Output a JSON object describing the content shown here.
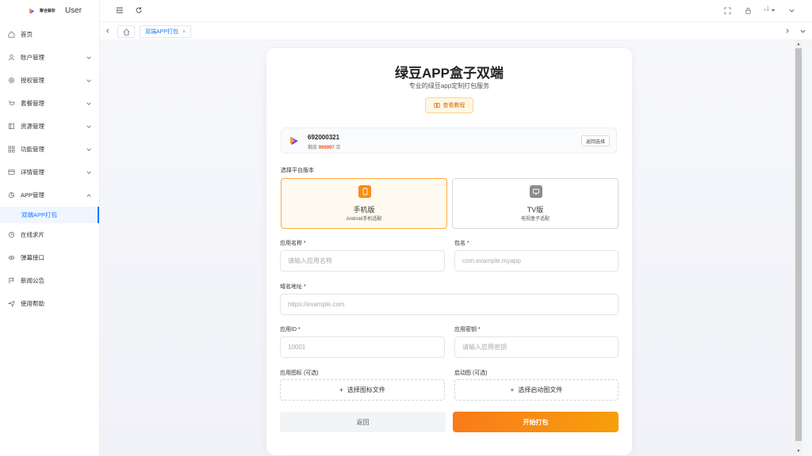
{
  "brand": {
    "name": "聚合解析",
    "user": "User"
  },
  "sidebar": {
    "items": [
      {
        "label": "首页",
        "icon": "home-icon"
      },
      {
        "label": "账户管理",
        "icon": "user-icon"
      },
      {
        "label": "授权管理",
        "icon": "gear-icon"
      },
      {
        "label": "套餐管理",
        "icon": "cart-icon"
      },
      {
        "label": "资源管理",
        "icon": "resource-icon"
      },
      {
        "label": "功能管理",
        "icon": "function-icon"
      },
      {
        "label": "详情管理",
        "icon": "detail-icon"
      },
      {
        "label": "APP管理",
        "icon": "app-icon"
      },
      {
        "label": "在线求片",
        "icon": "clock-icon"
      },
      {
        "label": "弹幕接口",
        "icon": "eye-icon"
      },
      {
        "label": "新闻公告",
        "icon": "flag-icon"
      },
      {
        "label": "使用帮助",
        "icon": "send-icon"
      }
    ],
    "sub_active": "双端APP打包"
  },
  "header": {
    "lang": "‹ ı̉"
  },
  "tabs": {
    "active": "双端APP打包"
  },
  "card": {
    "title": "绿豆APP盒子双端",
    "subtitle": "专业的绿豆app定制打包服务",
    "tutorial": "查看教程",
    "account": {
      "id": "692000321",
      "balance_prefix": "剩余",
      "balance": "999997",
      "balance_suffix": "次",
      "back": "返回选择"
    },
    "platform_label": "选择平台版本",
    "platforms": [
      {
        "name": "手机版",
        "desc": "Android手机适配"
      },
      {
        "name": "TV版",
        "desc": "电视盒子适配"
      }
    ],
    "fields": {
      "app_name": {
        "label": "应用名称",
        "placeholder": "请输入应用名称"
      },
      "package": {
        "label": "包名",
        "placeholder": "com.example.myapp"
      },
      "domain": {
        "label": "域名地址",
        "placeholder": "https://example.com"
      },
      "app_id": {
        "label": "应用ID",
        "placeholder": "10001"
      },
      "app_secret": {
        "label": "应用密钥",
        "placeholder": "请输入应用密钥"
      },
      "icon": {
        "label": "应用图标 (可选)",
        "button": "选择图标文件"
      },
      "splash": {
        "label": "启动图 (可选)",
        "button": "选择启动图文件"
      }
    },
    "back_button": "返回",
    "start_button": "开始打包"
  },
  "colors": {
    "accent": "#1677ff",
    "orange": "#fa7a1c"
  }
}
